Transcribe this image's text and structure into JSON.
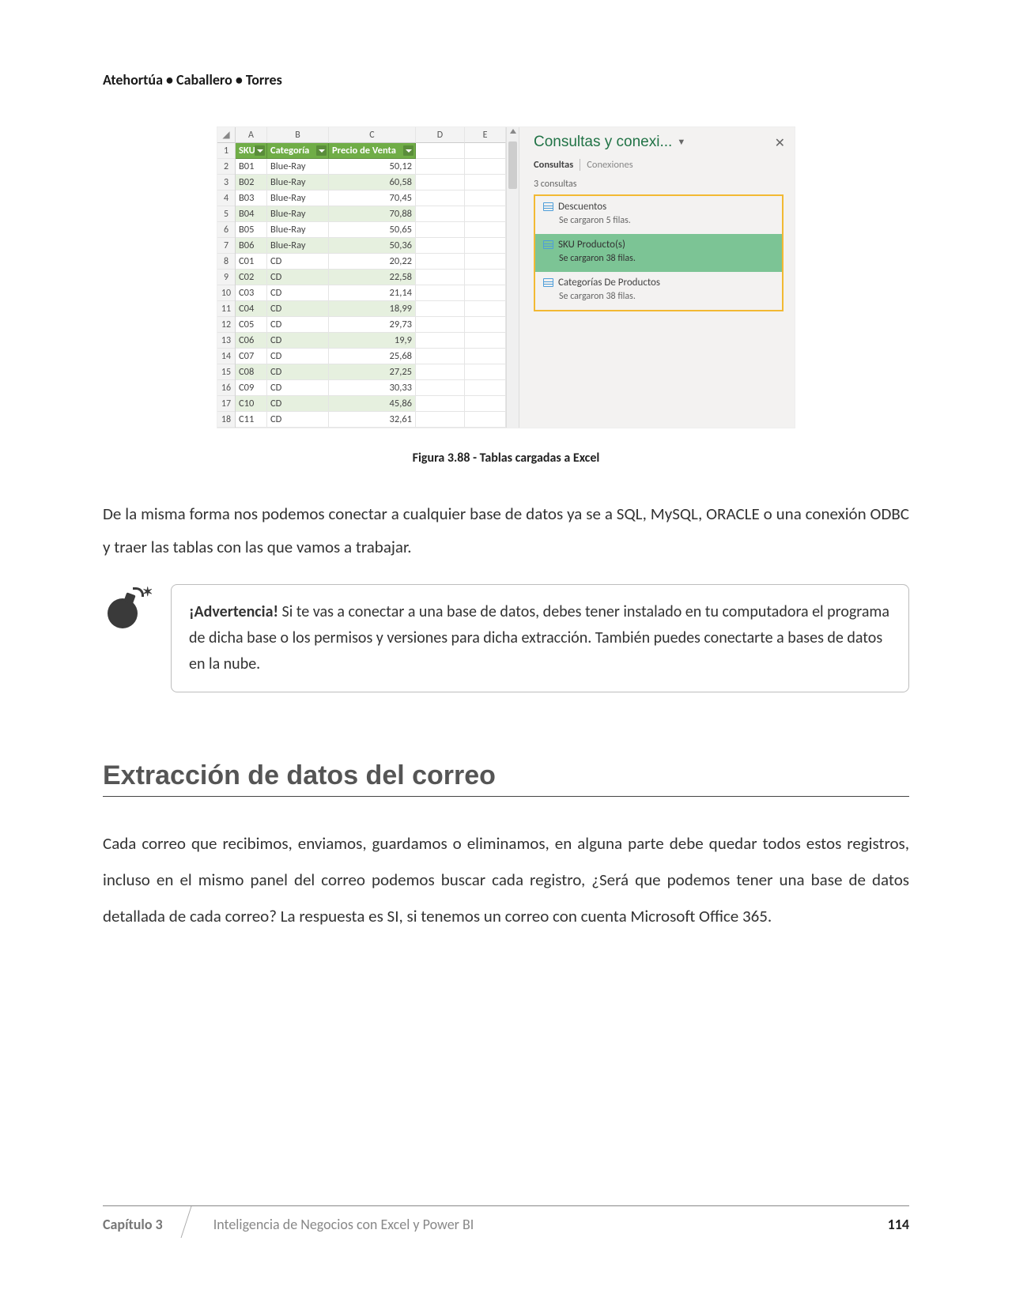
{
  "header": {
    "authors": "Atehortúa • Caballero • Torres"
  },
  "excel": {
    "columns": [
      "A",
      "B",
      "C",
      "D",
      "E"
    ],
    "headerRow": {
      "sku": "SKU",
      "cat": "Categoría",
      "price": "Precio de Venta"
    },
    "rows": [
      {
        "n": "2",
        "sku": "B01",
        "cat": "Blue-Ray",
        "price": "50,12",
        "striped": false
      },
      {
        "n": "3",
        "sku": "B02",
        "cat": "Blue-Ray",
        "price": "60,58",
        "striped": true
      },
      {
        "n": "4",
        "sku": "B03",
        "cat": "Blue-Ray",
        "price": "70,45",
        "striped": false
      },
      {
        "n": "5",
        "sku": "B04",
        "cat": "Blue-Ray",
        "price": "70,88",
        "striped": true
      },
      {
        "n": "6",
        "sku": "B05",
        "cat": "Blue-Ray",
        "price": "50,65",
        "striped": false
      },
      {
        "n": "7",
        "sku": "B06",
        "cat": "Blue-Ray",
        "price": "50,36",
        "striped": true
      },
      {
        "n": "8",
        "sku": "C01",
        "cat": "CD",
        "price": "20,22",
        "striped": false
      },
      {
        "n": "9",
        "sku": "C02",
        "cat": "CD",
        "price": "22,58",
        "striped": true
      },
      {
        "n": "10",
        "sku": "C03",
        "cat": "CD",
        "price": "21,14",
        "striped": false
      },
      {
        "n": "11",
        "sku": "C04",
        "cat": "CD",
        "price": "18,99",
        "striped": true
      },
      {
        "n": "12",
        "sku": "C05",
        "cat": "CD",
        "price": "29,73",
        "striped": false
      },
      {
        "n": "13",
        "sku": "C06",
        "cat": "CD",
        "price": "19,9",
        "striped": true
      },
      {
        "n": "14",
        "sku": "C07",
        "cat": "CD",
        "price": "25,68",
        "striped": false
      },
      {
        "n": "15",
        "sku": "C08",
        "cat": "CD",
        "price": "27,25",
        "striped": true
      },
      {
        "n": "16",
        "sku": "C09",
        "cat": "CD",
        "price": "30,33",
        "striped": false
      },
      {
        "n": "17",
        "sku": "C10",
        "cat": "CD",
        "price": "45,86",
        "striped": true
      },
      {
        "n": "18",
        "sku": "C11",
        "cat": "CD",
        "price": "32,61",
        "striped": false
      }
    ]
  },
  "pane": {
    "title": "Consultas y conexi...",
    "tab1": "Consultas",
    "tab2": "Conexiones",
    "count": "3 consultas",
    "items": [
      {
        "name": "Descuentos",
        "detail": "Se cargaron 5 filas.",
        "selected": false
      },
      {
        "name": "SKU Producto(s)",
        "detail": "Se cargaron 38 filas.",
        "selected": true
      },
      {
        "name": "Categorías De Productos",
        "detail": "Se cargaron 38 filas.",
        "selected": false
      }
    ]
  },
  "caption": "Figura 3.88 - Tablas cargadas a Excel",
  "para1": "De la misma forma nos podemos conectar a cualquier base de datos ya se a SQL, MySQL, ORACLE o una conexión ODBC y traer las tablas con las que vamos a trabajar.",
  "warning": {
    "bold": "¡Advertencia!",
    "text": " Si te vas a conectar a una base de datos, debes tener instalado en tu computadora el programa de dicha base o los permisos y versiones para dicha extracción. También puedes conectarte a bases de datos en la nube."
  },
  "sectionTitle": "Extracción de datos del correo",
  "para2": "Cada correo que recibimos, enviamos, guardamos o eliminamos, en alguna parte debe quedar todos estos registros, incluso en el mismo panel del correo podemos buscar cada registro, ¿Será que podemos tener una base de datos detallada de cada correo? La respuesta es SI, si tenemos un correo con cuenta Microsoft Office 365.",
  "footer": {
    "chapter": "Capítulo 3",
    "title": "Inteligencia de Negocios con Excel y Power BI",
    "page": "114"
  }
}
